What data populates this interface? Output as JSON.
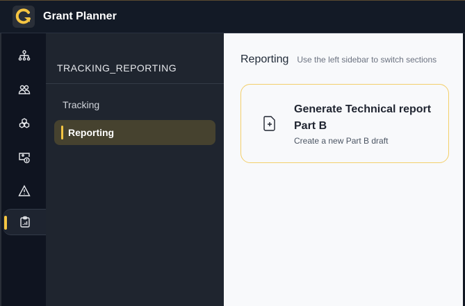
{
  "app": {
    "title": "Grant Planner",
    "accent": "#f5c542"
  },
  "rail": {
    "items": [
      {
        "icon": "hierarchy-icon"
      },
      {
        "icon": "users-icon"
      },
      {
        "icon": "boxes-icon"
      },
      {
        "icon": "money-icon"
      },
      {
        "icon": "warning-icon"
      },
      {
        "icon": "clipboard-chart-icon",
        "active": true
      }
    ]
  },
  "sidebar": {
    "title": "TRACKING_REPORTING",
    "items": [
      {
        "label": "Tracking"
      },
      {
        "label": "Reporting",
        "active": true
      }
    ]
  },
  "main": {
    "title": "Reporting",
    "subtitle": "Use the left sidebar to switch sections",
    "card": {
      "title": "Generate Technical report Part B",
      "subtitle": "Create a new Part B draft"
    }
  }
}
